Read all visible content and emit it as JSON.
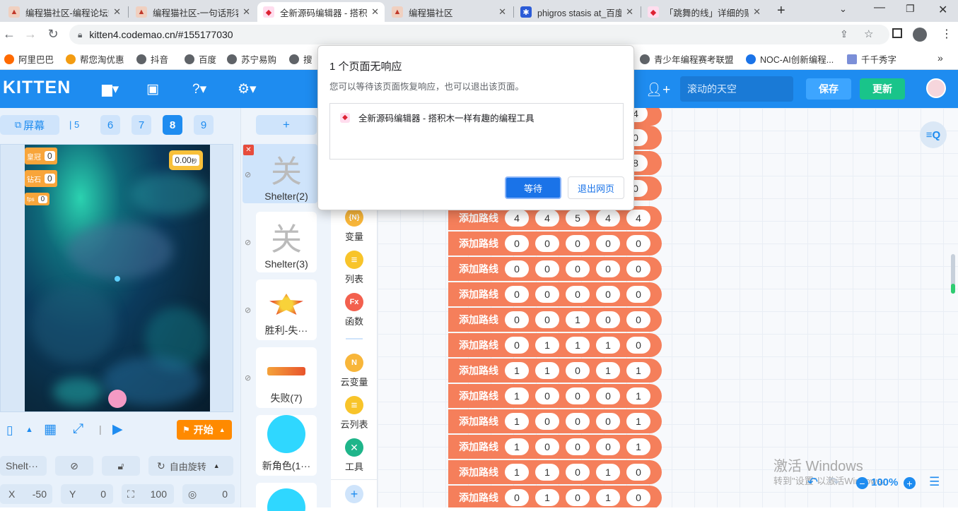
{
  "tabs": [
    {
      "title": "编程猫社区-编程论坛!",
      "active": false
    },
    {
      "title": "编程猫社区-一句话形容",
      "active": false
    },
    {
      "title": "全新源码编辑器 - 搭积",
      "active": true
    },
    {
      "title": "编程猫社区",
      "active": false
    },
    {
      "title": "phigros stasis at_百度",
      "active": false
    },
    {
      "title": "「跳舞的线」详细的贴",
      "active": false
    }
  ],
  "address": {
    "url": "kitten4.codemao.cn/#155177030"
  },
  "bookmarks": [
    "阿里巴巴",
    "帮您淘优惠",
    "抖音",
    "百度",
    "苏宁易购",
    "搜",
    "青少年编程赛考联盟",
    "NOC-AI创新编程...",
    "千千秀字"
  ],
  "header": {
    "logo": "KITTEN",
    "project_name": "滚动的天空",
    "save_label": "保存",
    "update_label": "更新"
  },
  "stage_panel": {
    "screen_label": "屏幕",
    "scene_tabs": [
      "5",
      "6",
      "7",
      "8",
      "9"
    ],
    "active_scene": "8",
    "vars": [
      {
        "name": "皇冠",
        "value": "0"
      },
      {
        "name": "钻石",
        "value": "0"
      },
      {
        "name": "fps",
        "value": "0"
      }
    ],
    "timer": "0.00",
    "timer_unit": "秒",
    "start_label": "开始",
    "sprite_name": "Shelt···",
    "rotation_label": "自由旋转",
    "x_label": "X",
    "x_value": "-50",
    "y_label": "Y",
    "y_value": "0",
    "size_value": "100",
    "dir_value": "0"
  },
  "sprites": [
    {
      "name": "Shelter(2)",
      "glyph": "关"
    },
    {
      "name": "Shelter(3)",
      "glyph": "关"
    },
    {
      "name": "胜利-失···",
      "glyph": ""
    },
    {
      "name": "失败(7)",
      "glyph": ""
    },
    {
      "name": "新角色(1···",
      "glyph": ""
    }
  ],
  "add_sprite_label": "+",
  "categories": [
    {
      "label": "变量",
      "icon": "{N}",
      "color": "#f8b63a"
    },
    {
      "label": "列表",
      "icon": "≡",
      "color": "#f8c42a"
    },
    {
      "label": "函数",
      "icon": "Fx",
      "color": "#f3604e"
    },
    {
      "label": "云变量",
      "icon": "N",
      "color": "#f8b63a"
    },
    {
      "label": "云列表",
      "icon": "≡",
      "color": "#f8c42a"
    },
    {
      "label": "工具",
      "icon": "✕",
      "color": "#1fb58a"
    }
  ],
  "blocks": {
    "label": "添加路线",
    "partial_rows": [
      "4",
      "0",
      "8",
      "0"
    ],
    "rows": [
      [
        "4",
        "4",
        "5",
        "4",
        "4"
      ],
      [
        "0",
        "0",
        "0",
        "0",
        "0"
      ],
      [
        "0",
        "0",
        "0",
        "0",
        "0"
      ],
      [
        "0",
        "0",
        "0",
        "0",
        "0"
      ],
      [
        "0",
        "0",
        "1",
        "0",
        "0"
      ],
      [
        "0",
        "1",
        "1",
        "1",
        "0"
      ],
      [
        "1",
        "1",
        "0",
        "1",
        "1"
      ],
      [
        "1",
        "0",
        "0",
        "0",
        "1"
      ],
      [
        "1",
        "0",
        "0",
        "0",
        "1"
      ],
      [
        "1",
        "0",
        "0",
        "0",
        "1"
      ],
      [
        "1",
        "1",
        "0",
        "1",
        "0"
      ],
      [
        "0",
        "1",
        "0",
        "1",
        "0"
      ]
    ]
  },
  "zoom": "100%",
  "watermark": {
    "line1": "激活 Windows",
    "line2": "转到\"设置\"以激活Windows。"
  },
  "dialog": {
    "title": "1 个页面无响应",
    "message": "您可以等待该页面恢复响应，也可以退出该页面。",
    "page_title": "全新源码编辑器 - 搭积木一样有趣的编程工具",
    "wait_label": "等待",
    "exit_label": "退出网页"
  }
}
